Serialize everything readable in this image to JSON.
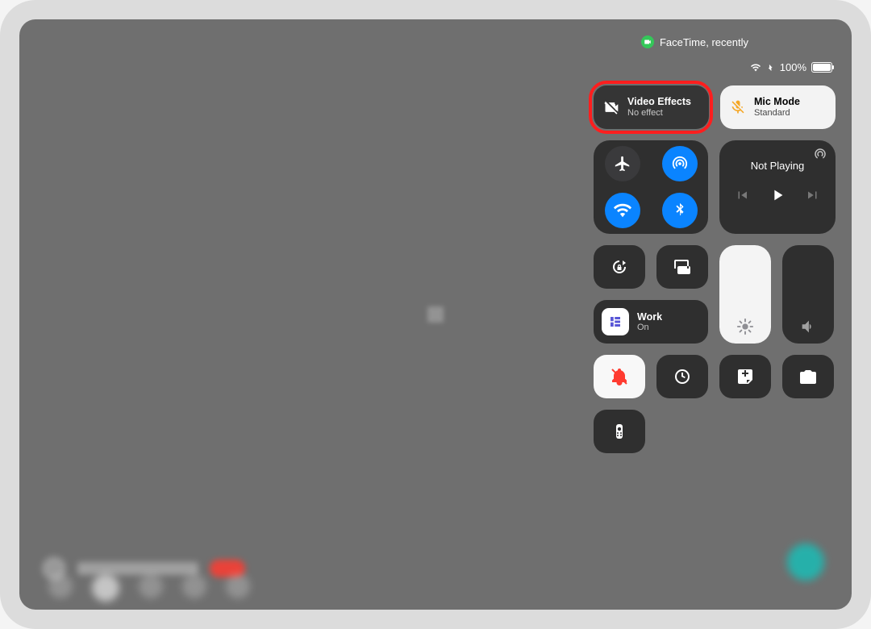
{
  "status": {
    "facetime_label": "FaceTime, recently",
    "battery_pct": "100%"
  },
  "video_effects": {
    "title": "Video Effects",
    "sub": "No effect"
  },
  "mic_mode": {
    "title": "Mic Mode",
    "sub": "Standard"
  },
  "now_playing": {
    "title": "Not Playing"
  },
  "focus": {
    "title": "Work",
    "sub": "On"
  },
  "brightness_pct": 100,
  "volume_pct": 0
}
